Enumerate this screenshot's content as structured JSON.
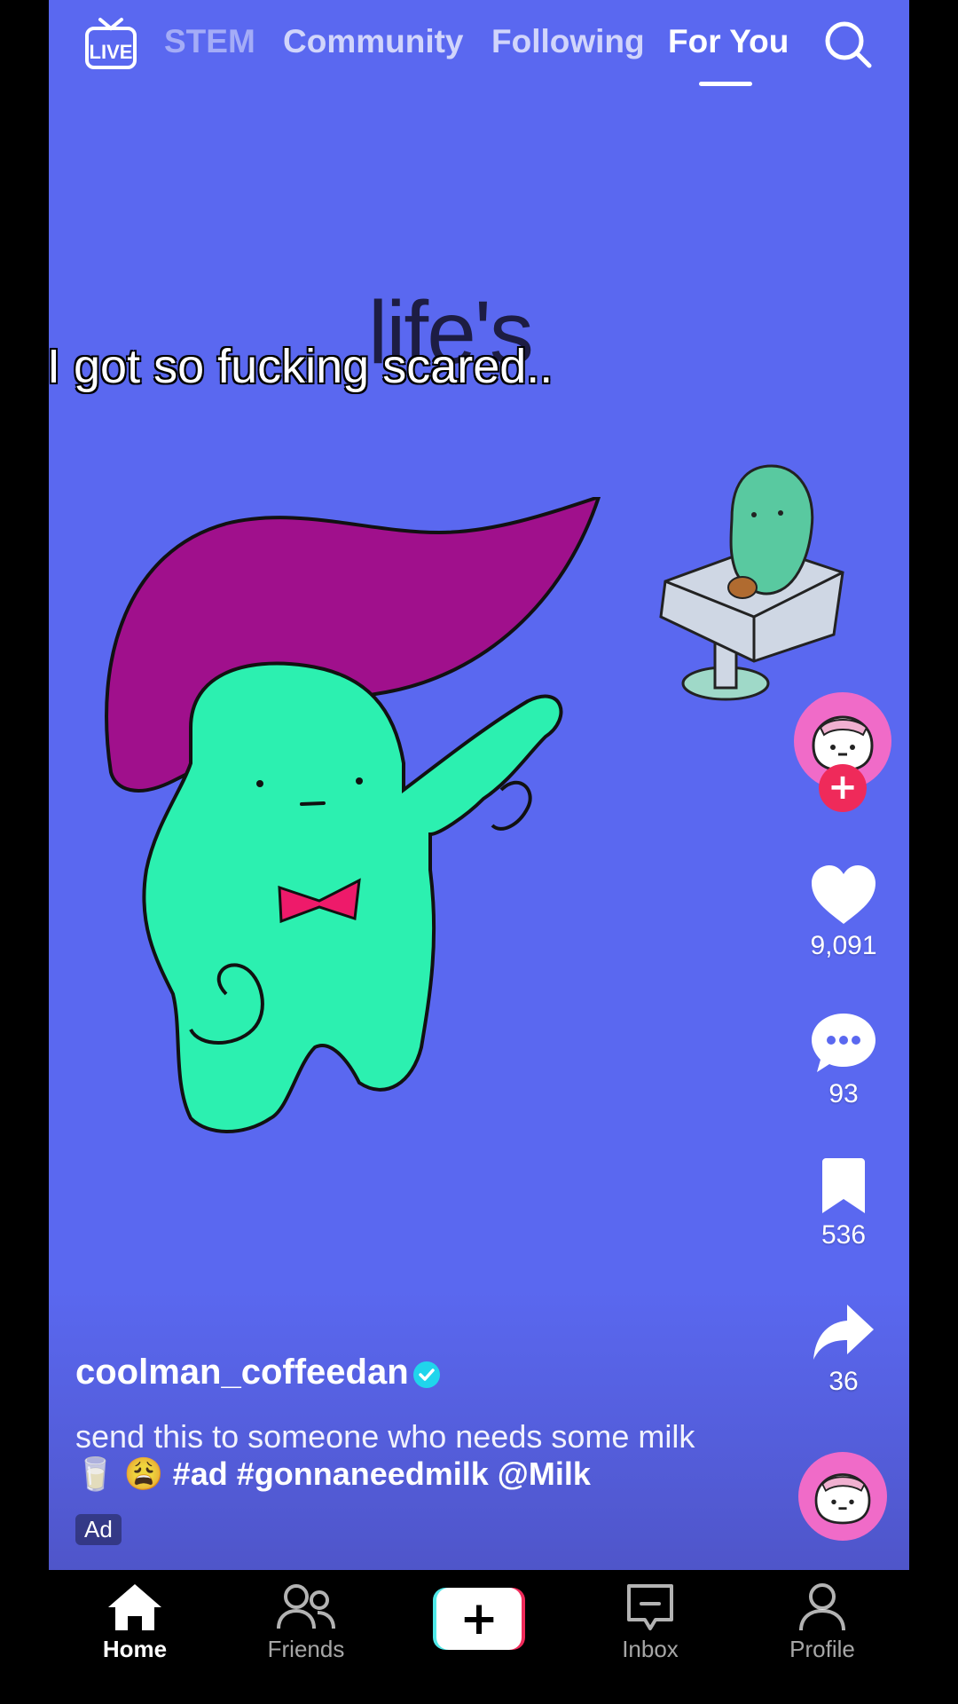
{
  "top_nav": {
    "live_label": "LIVE",
    "tabs": [
      {
        "label": "STEM"
      },
      {
        "label": "Community"
      },
      {
        "label": "Following"
      },
      {
        "label": "For You",
        "active": true
      }
    ]
  },
  "video": {
    "background_color": "#5a68f0",
    "background_text": "life's",
    "caption": "I got so fucking scared.."
  },
  "right_rail": {
    "likes": "9,091",
    "comments": "93",
    "saves": "536",
    "shares": "36"
  },
  "post": {
    "username": "coolman_coffeedan",
    "description": "send this to someone who needs some milk 🥛 😩",
    "tags": "#ad #gonnaneedmilk @Milk",
    "ad_badge": "Ad"
  },
  "bottom_nav": {
    "home": "Home",
    "friends": "Friends",
    "inbox": "Inbox",
    "profile": "Profile"
  },
  "colors": {
    "accent_red": "#ef2a5a",
    "accent_cyan": "#4fe8e8",
    "avatar_pink": "#f06bc8",
    "verified_blue": "#20d5ec"
  }
}
